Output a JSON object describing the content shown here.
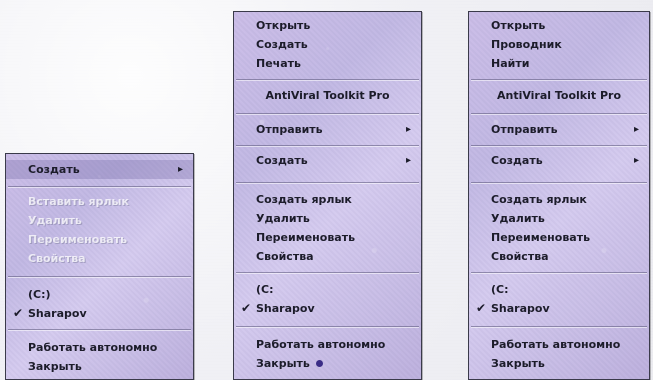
{
  "menus": {
    "left": {
      "items": [
        {
          "label": "Создать",
          "arrow": "▸"
        },
        {
          "label": "Вставить ярлык"
        },
        {
          "label": "Удалить"
        },
        {
          "label": "Переименовать"
        },
        {
          "label": "Свойства"
        },
        {
          "label": "(C:)"
        },
        {
          "label": "Sharapov",
          "check": "✔"
        },
        {
          "label": "Работать автономно"
        },
        {
          "label": "Закрыть"
        }
      ]
    },
    "middle": {
      "items": [
        {
          "label": "Открыть"
        },
        {
          "label": "Создать"
        },
        {
          "label": "Печать"
        },
        {
          "label": "AntiViral Toolkit Pro"
        },
        {
          "label": "Отправить",
          "arrow": "▸"
        },
        {
          "label": "Создать",
          "arrow": "▸"
        },
        {
          "label": "Создать ярлык"
        },
        {
          "label": "Удалить"
        },
        {
          "label": "Переименовать"
        },
        {
          "label": "Свойства"
        },
        {
          "label": "(C:"
        },
        {
          "label": "Sharapov",
          "check": "✔"
        },
        {
          "label": "Работать автономно"
        },
        {
          "label": "Закрыть"
        }
      ]
    },
    "right": {
      "items": [
        {
          "label": "Открыть"
        },
        {
          "label": "Проводник"
        },
        {
          "label": "Найти"
        },
        {
          "label": "AntiViral Toolkit Pro"
        },
        {
          "label": "Отправить",
          "arrow": "▸"
        },
        {
          "label": "Создать",
          "arrow": "▸"
        },
        {
          "label": "Создать ярлык"
        },
        {
          "label": "Удалить"
        },
        {
          "label": "Переименовать"
        },
        {
          "label": "Свойства"
        },
        {
          "label": "(C:"
        },
        {
          "label": "Sharapov",
          "check": "✔"
        },
        {
          "label": "Работать автономно"
        },
        {
          "label": "Закрыть"
        }
      ]
    }
  },
  "colors": {
    "menu_bg": "#c8bde6",
    "text": "#1c1c2a",
    "disabled_text": "#ffffff",
    "border": "#3a3a4a"
  },
  "icons": {
    "submenu": "arrow-right-icon",
    "checkmark": "check-icon",
    "cursor_dot": "cursor-dot-icon"
  }
}
